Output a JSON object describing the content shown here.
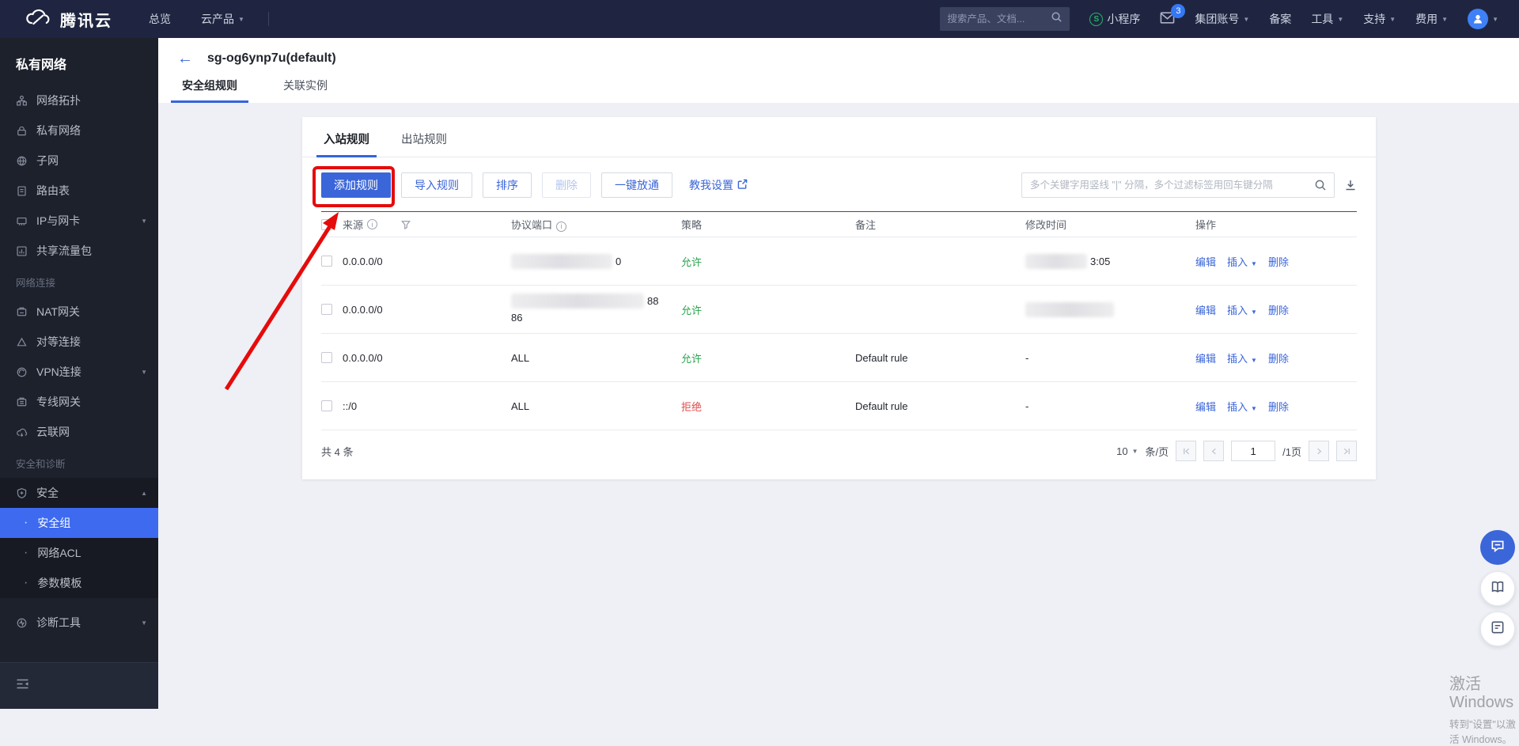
{
  "colors": {
    "accent": "#3b66d9",
    "selected": "#3e6af0",
    "allow": "#2ba44e",
    "deny": "#e04b4b",
    "annotation": "#e60b0b"
  },
  "topbar": {
    "brand": "腾讯云",
    "nav_overview": "总览",
    "nav_products": "云产品",
    "search_placeholder": "搜索产品、文档...",
    "mini_program": "小程序",
    "mail_badge": "3",
    "menu_group_account": "集团账号",
    "menu_beian": "备案",
    "menu_tools": "工具",
    "menu_support": "支持",
    "menu_billing": "费用"
  },
  "sidebar": {
    "title": "私有网络",
    "item_topology": "网络拓扑",
    "item_vpc": "私有网络",
    "item_subnet": "子网",
    "item_route": "路由表",
    "item_ip": "IP与网卡",
    "item_traffic": "共享流量包",
    "section_connect": "网络连接",
    "item_nat": "NAT网关",
    "item_peer": "对等连接",
    "item_vpn": "VPN连接",
    "item_dc": "专线网关",
    "item_ccn": "云联网",
    "section_security": "安全和诊断",
    "item_security": "安全",
    "sub_sg": "安全组",
    "sub_acl": "网络ACL",
    "sub_param": "参数模板",
    "item_diag": "诊断工具"
  },
  "page": {
    "title": "sg-og6ynp7u(default)",
    "tab_rules": "安全组规则",
    "tab_instances": "关联实例"
  },
  "panel": {
    "tab_inbound": "入站规则",
    "tab_outbound": "出站规则",
    "btn_add": "添加规则",
    "btn_import": "导入规则",
    "btn_sort": "排序",
    "btn_delete": "删除",
    "btn_open_all": "一键放通",
    "link_teach": "教我设置",
    "search_placeholder": "多个关键字用竖线 \"|\" 分隔，多个过滤标签用回车键分隔"
  },
  "table": {
    "col_source": "来源",
    "col_protocol": "协议端口",
    "col_policy": "策略",
    "col_notes": "备注",
    "col_modified": "修改时间",
    "col_actions": "操作",
    "action_edit": "编辑",
    "action_insert": "插入",
    "action_delete": "删除",
    "rows": [
      {
        "source": "0.0.0.0/0",
        "protocol_tail": "0",
        "policy": "允许",
        "notes": "",
        "modified_tail": "3:05"
      },
      {
        "source": "0.0.0.0/0",
        "protocol_tail": "88",
        "protocol_line2": "86",
        "policy": "允许",
        "notes": "",
        "modified_tail": ""
      },
      {
        "source": "0.0.0.0/0",
        "protocol": "ALL",
        "policy": "允许",
        "notes": "Default rule",
        "modified": "-"
      },
      {
        "source": "::/0",
        "protocol": "ALL",
        "policy": "拒绝",
        "notes": "Default rule",
        "modified": "-"
      }
    ]
  },
  "footer": {
    "total": "共 4 条",
    "page_size": "10",
    "per_page": "条/页",
    "page": "1",
    "page_total": "/1页"
  },
  "watermark": {
    "line1": "激活 Windows",
    "line2": "转到\"设置\"以激活 Windows。"
  }
}
